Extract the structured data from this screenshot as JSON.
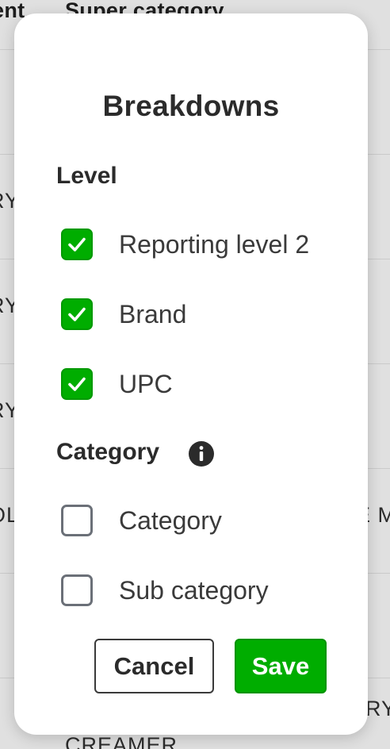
{
  "background": {
    "header": {
      "left_col": "ent",
      "right_col": "Super category"
    },
    "rows": [
      {
        "left": "RY",
        "right": ""
      },
      {
        "left": "RY",
        "right": ""
      },
      {
        "left": "RY",
        "right": ""
      },
      {
        "left": "OL",
        "right": "E M"
      },
      {
        "left": "",
        "right": ""
      },
      {
        "left": "",
        "right": "RY"
      }
    ],
    "footer_text": "CREAMER"
  },
  "modal": {
    "title": "Breakdowns",
    "level_section": {
      "heading": "Level",
      "options": [
        {
          "label": "Reporting level 2",
          "checked": true
        },
        {
          "label": "Brand",
          "checked": true
        },
        {
          "label": "UPC",
          "checked": true
        }
      ]
    },
    "category_section": {
      "heading": "Category",
      "info_icon": "info-icon",
      "options": [
        {
          "label": "Category",
          "checked": false
        },
        {
          "label": "Sub category",
          "checked": false
        }
      ]
    },
    "buttons": {
      "cancel_label": "Cancel",
      "save_label": "Save"
    }
  },
  "colors": {
    "accent_green": "#00ad00",
    "checkbox_border_unchecked": "#6b7078",
    "text_dark": "#2b2b2b"
  }
}
